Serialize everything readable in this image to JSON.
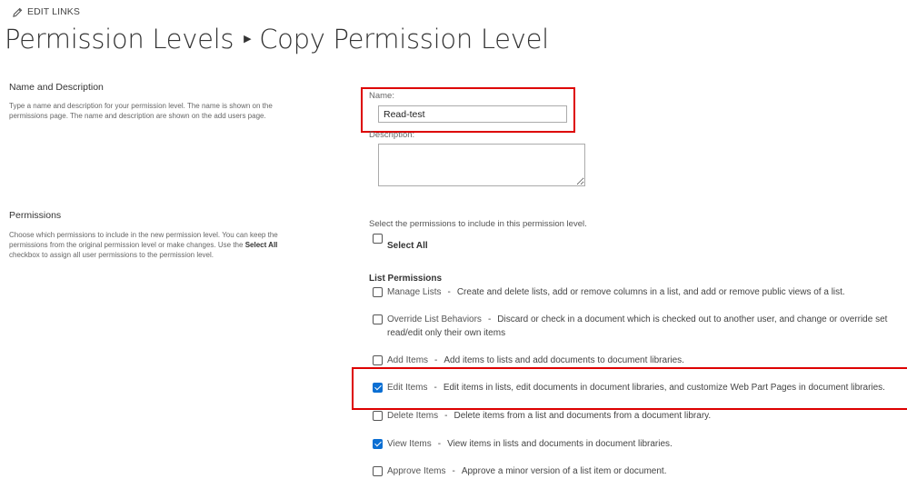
{
  "header": {
    "edit_links": "EDIT LINKS",
    "breadcrumb_parent": "Permission Levels",
    "breadcrumb_current": "Copy Permission Level"
  },
  "name_section": {
    "heading": "Name and Description",
    "description_line1": "Type a name and description for your permission level.  The name is shown on the",
    "description_line2": "permissions page.  The name and description are shown on the add users page.",
    "name_label": "Name:",
    "name_value": "Read-test",
    "description_label": "Description:",
    "description_value": ""
  },
  "permissions_section": {
    "heading": "Permissions",
    "desc_line1": "Choose which permissions to include in the new permission level.  You can keep the",
    "desc_line2_prefix": "permissions from the original permission level or make changes.  Use the",
    "desc_line2_bold": "Select All",
    "desc_line3": "checkbox to assign all user permissions to the permission level.",
    "intro": "Select the permissions to include in this permission level.",
    "select_all_label": "Select All",
    "select_all_checked": false,
    "list_permissions_heading": "List Permissions",
    "items": [
      {
        "name": "Manage Lists",
        "description": "Create and delete lists, add or remove columns in a list, and add or remove public views of a list.",
        "checked": false
      },
      {
        "name": "Override List Behaviors",
        "description": "Discard or check in a document which is checked out to another user, and change or override set",
        "description_line2": "read/edit only their own items",
        "checked": false
      },
      {
        "name": "Add Items",
        "description": "Add items to lists and add documents to document libraries.",
        "checked": false
      },
      {
        "name": "Edit Items",
        "description": "Edit items in lists, edit documents in document libraries, and customize Web Part Pages in document libraries.",
        "checked": true
      },
      {
        "name": "Delete Items",
        "description": "Delete items from a list and documents from a document library.",
        "checked": false
      },
      {
        "name": "View Items",
        "description": "View items in lists and documents in document libraries.",
        "checked": true
      },
      {
        "name": "Approve Items",
        "description": "Approve a minor version of a list item or document.",
        "checked": false
      }
    ],
    "separator": "-"
  },
  "colors": {
    "highlight_border": "#dd0000",
    "checkbox_checked": "#0b6fd3"
  },
  "icons": {
    "edit_links": "pencil-icon",
    "breadcrumb_separator": "triangle-right-icon"
  }
}
